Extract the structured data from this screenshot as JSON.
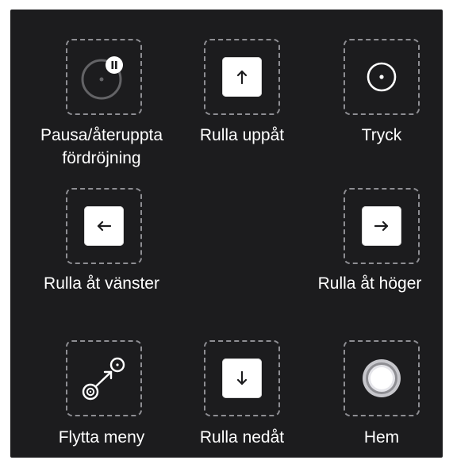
{
  "menu": {
    "items": {
      "pause": {
        "label_line1": "Pausa/återuppta",
        "label_line2": "fördröjning",
        "icon": "pause-dwell-icon"
      },
      "scroll_up": {
        "label": "Rulla uppåt",
        "icon": "arrow-up-icon"
      },
      "tap": {
        "label": "Tryck",
        "icon": "tap-icon"
      },
      "scroll_left": {
        "label": "Rulla åt vänster",
        "icon": "arrow-left-icon"
      },
      "scroll_right": {
        "label": "Rulla åt höger",
        "icon": "arrow-right-icon"
      },
      "move_menu": {
        "label": "Flytta meny",
        "icon": "move-menu-icon"
      },
      "scroll_down": {
        "label": "Rulla nedåt",
        "icon": "arrow-down-icon"
      },
      "home": {
        "label": "Hem",
        "icon": "home-button-icon"
      }
    }
  },
  "colors": {
    "panel_background": "#1c1c1e",
    "tile_border": "#8e8e93",
    "text": "#ffffff",
    "keycap": "#ffffff"
  }
}
